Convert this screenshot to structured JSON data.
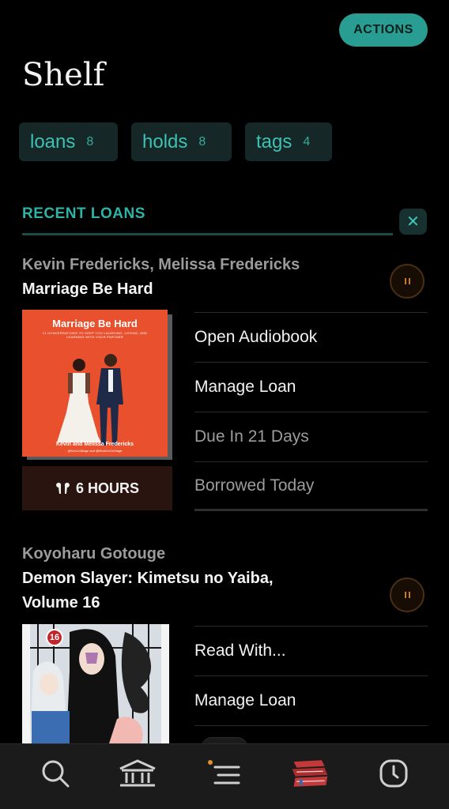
{
  "header": {
    "actions_label": "ACTIONS",
    "title": "Shelf"
  },
  "filters": [
    {
      "label": "loans",
      "count": "8"
    },
    {
      "label": "holds",
      "count": "8"
    },
    {
      "label": "tags",
      "count": "4"
    }
  ],
  "section": {
    "title": "RECENT LOANS",
    "close_icon": "close-icon"
  },
  "loans": [
    {
      "author": "Kevin Fredericks, Melissa Fredericks",
      "title": "Marriage Be Hard",
      "cover_title": "Marriage Be Hard",
      "cover_subtitle": "12 CONVERSATIONS TO KEEP YOU LAUGHING, LOVING, AND LEARNING WITH YOUR PARTNER",
      "cover_authors": "Kevin and Melissa Fredericks",
      "cover_handles": "@KevOnStage and @MrsKevOnStage",
      "duration": "6 HOURS",
      "actions": [
        "Open Audiobook",
        "Manage Loan",
        "Due In 21 Days",
        "Borrowed Today"
      ]
    },
    {
      "author": "Koyoharu Gotouge",
      "title_line1": "Demon Slayer: Kimetsu no Yaiba,",
      "title_line2": "Volume 16",
      "volume_badge": "16",
      "actions": [
        "Read With...",
        "Manage Loan"
      ]
    }
  ],
  "nav": {
    "items": [
      "search-icon",
      "library-icon",
      "menu-icon",
      "books-icon",
      "clock-icon"
    ],
    "active": "books-icon",
    "colors": {
      "accent": "#2a9d92",
      "active": "#c43a3a",
      "indicator": "#e0902a"
    }
  }
}
